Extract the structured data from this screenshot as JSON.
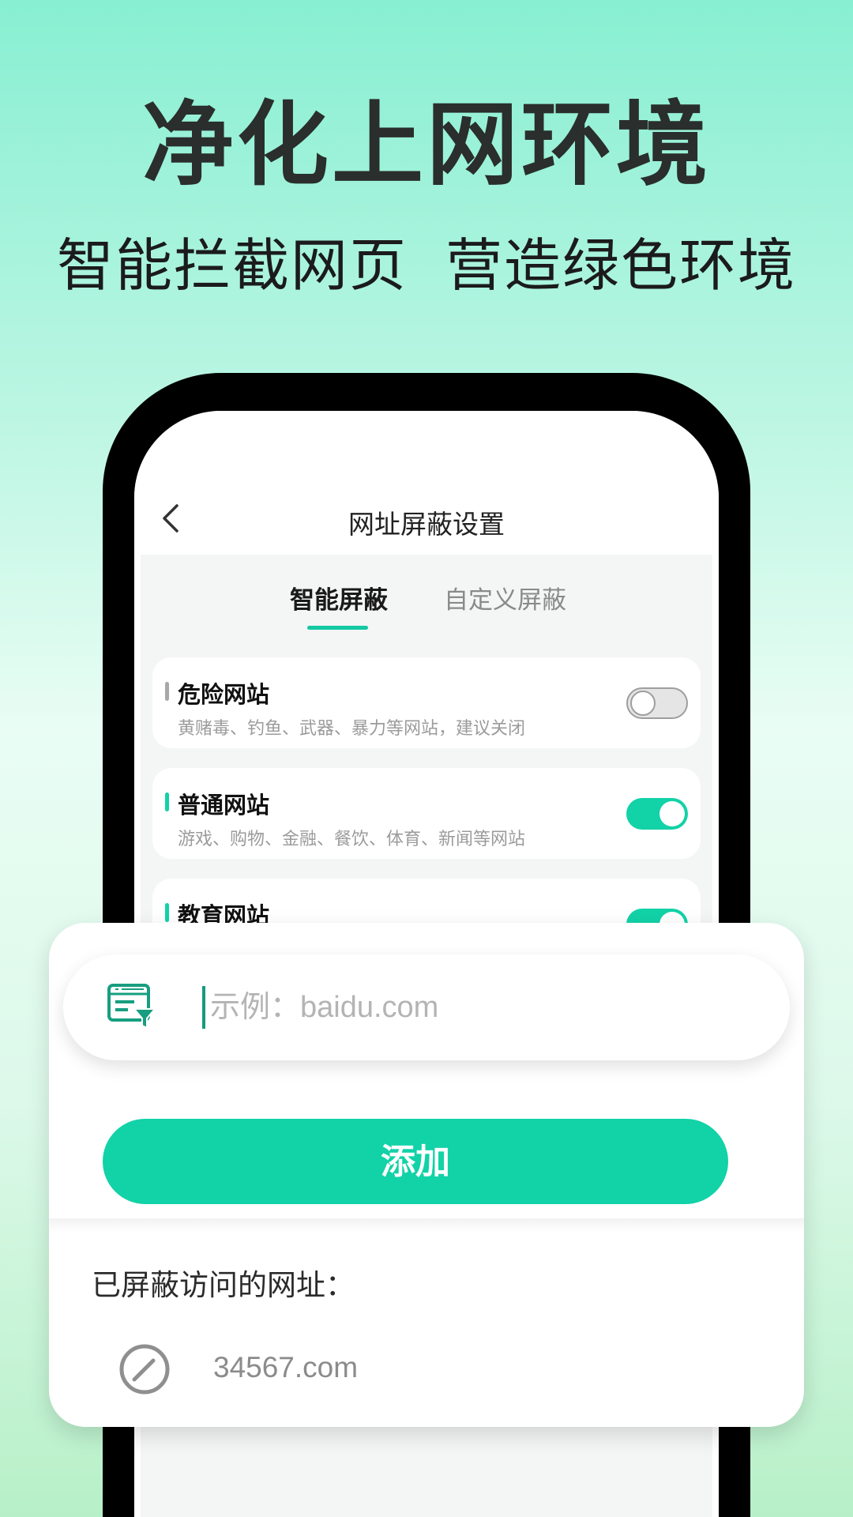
{
  "headline": "净化上网环境",
  "subline": [
    "智能拦截网页",
    "营造绿色环境"
  ],
  "phone": {
    "nav": {
      "title": "网址屏蔽设置"
    },
    "tabs": [
      {
        "label": "智能屏蔽",
        "active": true
      },
      {
        "label": "自定义屏蔽",
        "active": false
      }
    ],
    "cards": [
      {
        "title": "危险网站",
        "desc": "黄赌毒、钓鱼、武器、暴力等网站，建议关闭",
        "enabled": false,
        "bar_color": "#a8a8a8"
      },
      {
        "title": "普通网站",
        "desc": "游戏、购物、金融、餐饮、体育、新闻等网站",
        "enabled": true,
        "bar_color": "#12d2a7"
      },
      {
        "title": "教育网站",
        "desc": "",
        "enabled": true,
        "bar_color": "#12d2a7"
      }
    ]
  },
  "overlay": {
    "input": {
      "placeholder": "示例：baidu.com",
      "value": ""
    },
    "add_button_label": "添加",
    "blocked_label": "已屏蔽访问的网址：",
    "blocked_sites": [
      "34567.com"
    ]
  },
  "colors": {
    "accent": "#12d2a7",
    "toggle_off": "#e5e5e5",
    "headline_text": "#2a2e2c"
  },
  "icons": {
    "back": "chevron-left-icon",
    "filter": "url-filter-icon",
    "blocked": "ban-icon"
  }
}
